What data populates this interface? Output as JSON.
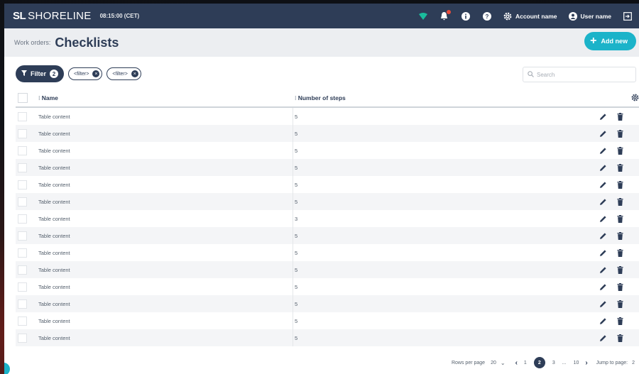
{
  "navbar": {
    "logo": "SL",
    "brand": "SHORELINE",
    "time": "08:15:00 (CET)",
    "account_label": "Account name",
    "user_label": "User name",
    "accent": "#2e3d57",
    "signal_color": "#1abc9c",
    "notification_color": "#e74c3c"
  },
  "header": {
    "breadcrumb": "Work orders:",
    "title": "Checklists",
    "add_label": "Add new",
    "add_color": "#1bb3c9"
  },
  "filters": {
    "button_label": "Filter",
    "count": "2",
    "chips": [
      "<filter>",
      "<filter>"
    ]
  },
  "search": {
    "placeholder": "Search"
  },
  "table": {
    "columns": [
      "Name",
      "Number of steps"
    ],
    "rows": [
      {
        "name": "Table content",
        "steps": "5"
      },
      {
        "name": "Table content",
        "steps": "5"
      },
      {
        "name": "Table content",
        "steps": "5"
      },
      {
        "name": "Table content",
        "steps": "5"
      },
      {
        "name": "Table content",
        "steps": "5"
      },
      {
        "name": "Table content",
        "steps": "5"
      },
      {
        "name": "Table content",
        "steps": "3"
      },
      {
        "name": "Table content",
        "steps": "5"
      },
      {
        "name": "Table content",
        "steps": "5"
      },
      {
        "name": "Table content",
        "steps": "5"
      },
      {
        "name": "Table content",
        "steps": "5"
      },
      {
        "name": "Table content",
        "steps": "5"
      },
      {
        "name": "Table content",
        "steps": "5"
      },
      {
        "name": "Table content",
        "steps": "5"
      }
    ]
  },
  "pagination": {
    "rows_per_page_label": "Rows per page",
    "rows_per_page_value": "20",
    "pages": [
      "1",
      "2",
      "3",
      "...",
      "10"
    ],
    "active_page": "2",
    "jump_label": "Jump to page:",
    "jump_value": "2"
  }
}
